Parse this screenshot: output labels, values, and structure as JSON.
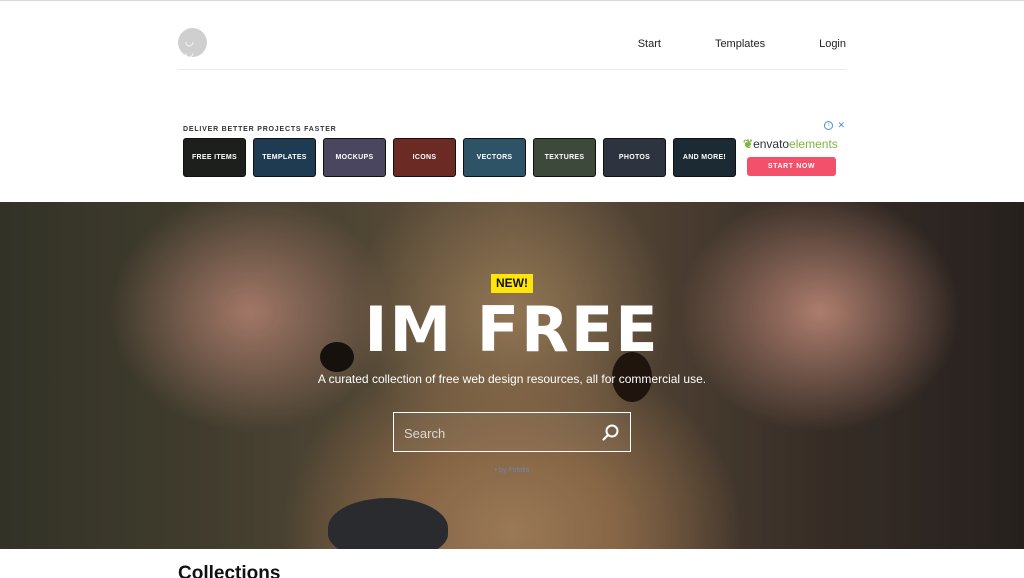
{
  "header": {
    "logo_face": "◡ ◡",
    "nav": [
      "Start",
      "Templates",
      "Login"
    ]
  },
  "ad": {
    "tagline": "DELIVER BETTER PROJECTS FASTER",
    "tiles": [
      {
        "label": "FREE ITEMS",
        "color": "#1d1f1c"
      },
      {
        "label": "TEMPLATES",
        "color": "#1f3b52"
      },
      {
        "label": "MOCKUPS",
        "color": "#4a4660"
      },
      {
        "label": "ICONS",
        "color": "#6b2a24"
      },
      {
        "label": "VECTORS",
        "color": "#2f5366"
      },
      {
        "label": "TEXTURES",
        "color": "#3d4a3b"
      },
      {
        "label": "PHOTOS",
        "color": "#2d3440"
      },
      {
        "label": "AND MORE!",
        "color": "#1b2a33"
      }
    ],
    "brand_main": "envato",
    "brand_suffix": "elements",
    "cta": "START NOW",
    "close": "✕"
  },
  "hero": {
    "badge": "NEW!",
    "title": "IM FREE",
    "subtitle": "A curated collection of free web design resources, all for commercial use.",
    "search_placeholder": "Search",
    "credit": "• by Fotolia"
  },
  "sections": {
    "collections_title": "Collections"
  },
  "colors": {
    "badge": "#ffe60a",
    "cta": "#f2506b",
    "envato_green": "#82b440"
  }
}
